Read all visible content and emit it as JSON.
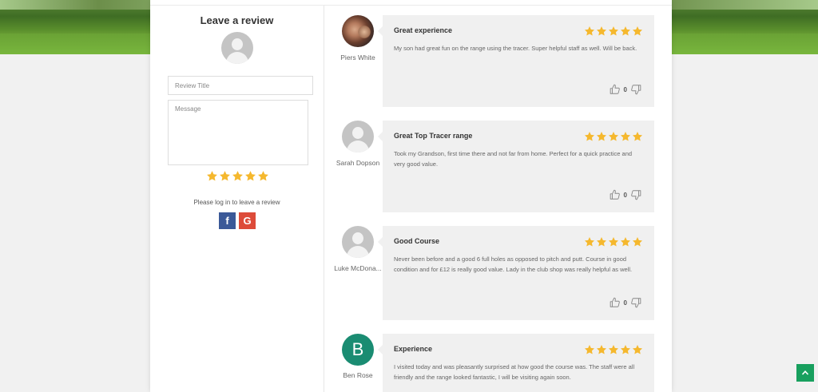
{
  "form": {
    "title": "Leave a review",
    "review_title_placeholder": "Review Title",
    "message_placeholder": "Message",
    "rating": 5,
    "login_prompt": "Please log in to leave a review",
    "facebook_label": "f",
    "google_label": "G"
  },
  "colors": {
    "star": "#f5b82e",
    "facebook": "#3b5998",
    "google": "#dd4b39",
    "scroll_top": "#18a05e",
    "avatar_letter_bg": "#1a8c72"
  },
  "reviews": [
    {
      "name": "Piers White",
      "avatar": "photo",
      "title": "Great experience",
      "rating": 5,
      "text": "My son had great fun on the range using the tracer. Super helpful staff as well. Will be back.",
      "votes": "0"
    },
    {
      "name": "Sarah Dopson",
      "avatar": "generic",
      "title": "Great Top Tracer range",
      "rating": 5,
      "text": "Took my Grandson, first time there and not far from home. Perfect for a quick practice and very good value.",
      "votes": "0"
    },
    {
      "name": "Luke McDona...",
      "avatar": "generic",
      "title": "Good Course",
      "rating": 5,
      "text": "Never been before and a good 6 full holes as opposed to pitch and putt. Course in good condition and for £12 is really good value. Lady in the club shop was really helpful as well.",
      "votes": "0"
    },
    {
      "name": "Ben Rose",
      "avatar": "letter",
      "avatar_letter": "B",
      "title": "Experience",
      "rating": 5,
      "text": "I visited today and was pleasantly surprised at how good the course was. The staff were all friendly and the range looked fantastic, I will be visiting again soon.",
      "votes": ""
    }
  ]
}
